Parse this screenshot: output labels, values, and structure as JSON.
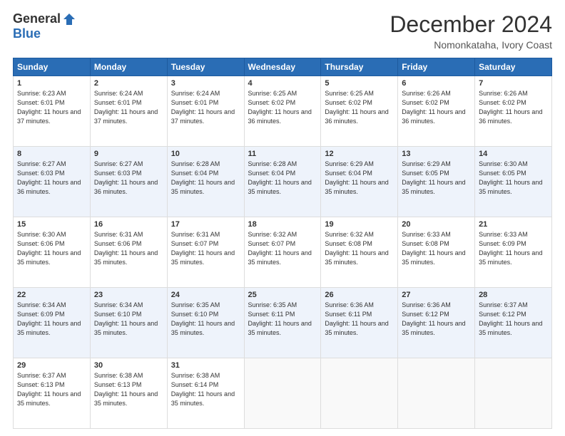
{
  "logo": {
    "general": "General",
    "blue": "Blue"
  },
  "title": "December 2024",
  "subtitle": "Nomonkataha, Ivory Coast",
  "days_header": [
    "Sunday",
    "Monday",
    "Tuesday",
    "Wednesday",
    "Thursday",
    "Friday",
    "Saturday"
  ],
  "weeks": [
    {
      "stripe": false,
      "days": [
        {
          "num": "1",
          "sunrise": "6:23 AM",
          "sunset": "6:01 PM",
          "daylight": "11 hours and 37 minutes."
        },
        {
          "num": "2",
          "sunrise": "6:24 AM",
          "sunset": "6:01 PM",
          "daylight": "11 hours and 37 minutes."
        },
        {
          "num": "3",
          "sunrise": "6:24 AM",
          "sunset": "6:01 PM",
          "daylight": "11 hours and 37 minutes."
        },
        {
          "num": "4",
          "sunrise": "6:25 AM",
          "sunset": "6:02 PM",
          "daylight": "11 hours and 36 minutes."
        },
        {
          "num": "5",
          "sunrise": "6:25 AM",
          "sunset": "6:02 PM",
          "daylight": "11 hours and 36 minutes."
        },
        {
          "num": "6",
          "sunrise": "6:26 AM",
          "sunset": "6:02 PM",
          "daylight": "11 hours and 36 minutes."
        },
        {
          "num": "7",
          "sunrise": "6:26 AM",
          "sunset": "6:02 PM",
          "daylight": "11 hours and 36 minutes."
        }
      ]
    },
    {
      "stripe": true,
      "days": [
        {
          "num": "8",
          "sunrise": "6:27 AM",
          "sunset": "6:03 PM",
          "daylight": "11 hours and 36 minutes."
        },
        {
          "num": "9",
          "sunrise": "6:27 AM",
          "sunset": "6:03 PM",
          "daylight": "11 hours and 36 minutes."
        },
        {
          "num": "10",
          "sunrise": "6:28 AM",
          "sunset": "6:04 PM",
          "daylight": "11 hours and 35 minutes."
        },
        {
          "num": "11",
          "sunrise": "6:28 AM",
          "sunset": "6:04 PM",
          "daylight": "11 hours and 35 minutes."
        },
        {
          "num": "12",
          "sunrise": "6:29 AM",
          "sunset": "6:04 PM",
          "daylight": "11 hours and 35 minutes."
        },
        {
          "num": "13",
          "sunrise": "6:29 AM",
          "sunset": "6:05 PM",
          "daylight": "11 hours and 35 minutes."
        },
        {
          "num": "14",
          "sunrise": "6:30 AM",
          "sunset": "6:05 PM",
          "daylight": "11 hours and 35 minutes."
        }
      ]
    },
    {
      "stripe": false,
      "days": [
        {
          "num": "15",
          "sunrise": "6:30 AM",
          "sunset": "6:06 PM",
          "daylight": "11 hours and 35 minutes."
        },
        {
          "num": "16",
          "sunrise": "6:31 AM",
          "sunset": "6:06 PM",
          "daylight": "11 hours and 35 minutes."
        },
        {
          "num": "17",
          "sunrise": "6:31 AM",
          "sunset": "6:07 PM",
          "daylight": "11 hours and 35 minutes."
        },
        {
          "num": "18",
          "sunrise": "6:32 AM",
          "sunset": "6:07 PM",
          "daylight": "11 hours and 35 minutes."
        },
        {
          "num": "19",
          "sunrise": "6:32 AM",
          "sunset": "6:08 PM",
          "daylight": "11 hours and 35 minutes."
        },
        {
          "num": "20",
          "sunrise": "6:33 AM",
          "sunset": "6:08 PM",
          "daylight": "11 hours and 35 minutes."
        },
        {
          "num": "21",
          "sunrise": "6:33 AM",
          "sunset": "6:09 PM",
          "daylight": "11 hours and 35 minutes."
        }
      ]
    },
    {
      "stripe": true,
      "days": [
        {
          "num": "22",
          "sunrise": "6:34 AM",
          "sunset": "6:09 PM",
          "daylight": "11 hours and 35 minutes."
        },
        {
          "num": "23",
          "sunrise": "6:34 AM",
          "sunset": "6:10 PM",
          "daylight": "11 hours and 35 minutes."
        },
        {
          "num": "24",
          "sunrise": "6:35 AM",
          "sunset": "6:10 PM",
          "daylight": "11 hours and 35 minutes."
        },
        {
          "num": "25",
          "sunrise": "6:35 AM",
          "sunset": "6:11 PM",
          "daylight": "11 hours and 35 minutes."
        },
        {
          "num": "26",
          "sunrise": "6:36 AM",
          "sunset": "6:11 PM",
          "daylight": "11 hours and 35 minutes."
        },
        {
          "num": "27",
          "sunrise": "6:36 AM",
          "sunset": "6:12 PM",
          "daylight": "11 hours and 35 minutes."
        },
        {
          "num": "28",
          "sunrise": "6:37 AM",
          "sunset": "6:12 PM",
          "daylight": "11 hours and 35 minutes."
        }
      ]
    },
    {
      "stripe": false,
      "days": [
        {
          "num": "29",
          "sunrise": "6:37 AM",
          "sunset": "6:13 PM",
          "daylight": "11 hours and 35 minutes."
        },
        {
          "num": "30",
          "sunrise": "6:38 AM",
          "sunset": "6:13 PM",
          "daylight": "11 hours and 35 minutes."
        },
        {
          "num": "31",
          "sunrise": "6:38 AM",
          "sunset": "6:14 PM",
          "daylight": "11 hours and 35 minutes."
        },
        null,
        null,
        null,
        null
      ]
    }
  ]
}
